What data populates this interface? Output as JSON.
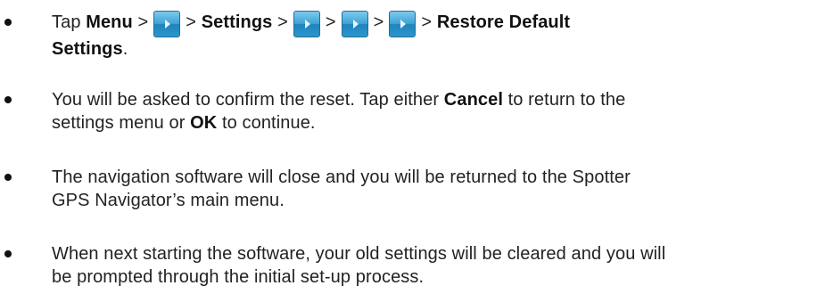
{
  "bullets": [
    {
      "p1": "Tap ",
      "b1": "Menu",
      "p2": " >",
      "p3": "> ",
      "b2": "Settings",
      "p4": " >",
      "p5": ">",
      "p6": ">",
      "p7": "> ",
      "b3": "Restore Default",
      "b4": "Settings",
      "p8": ".",
      "icons": [
        "arrow-button-icon",
        "arrow-button-icon",
        "arrow-button-icon",
        "arrow-button-icon"
      ]
    },
    {
      "line1_pre": "You will be asked to confirm the reset.  Tap either ",
      "cancel": "Cancel",
      "line1_post": " to return to the",
      "line2_pre": "settings menu or ",
      "ok": "OK",
      "line2_post": " to continue."
    },
    {
      "line1": "The navigation software will close and you will be returned to the Spotter",
      "line2": "GPS Navigator’s main menu."
    },
    {
      "line1": "When next starting the software, your old settings will be cleared and you will",
      "line2": "be prompted through the initial set-up process."
    }
  ],
  "colors": {
    "text": "#222222",
    "button_top": "#7fc9ec",
    "button_bottom": "#1f84bc"
  }
}
